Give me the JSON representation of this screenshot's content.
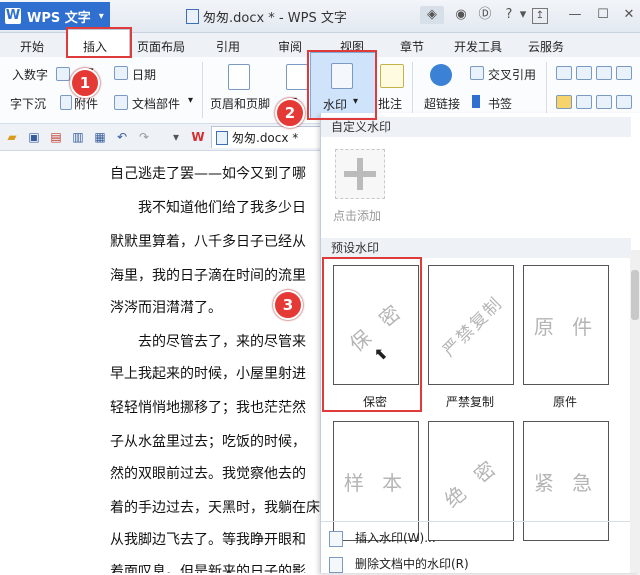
{
  "titlebar": {
    "app_name": "WPS 文字",
    "doc_title": "匆匆.docx * - WPS 文字",
    "help": "?"
  },
  "tabs": [
    {
      "label": "开始"
    },
    {
      "label": "插入"
    },
    {
      "label": "页面布局"
    },
    {
      "label": "引用"
    },
    {
      "label": "审阅"
    },
    {
      "label": "视图"
    },
    {
      "label": "章节"
    },
    {
      "label": "开发工具"
    },
    {
      "label": "云服务"
    }
  ],
  "ribbon": {
    "number": "入数字",
    "date": "日期",
    "sink": "字下沉",
    "attachment": "附件",
    "doc_parts": "文档部件",
    "header_footer": "页眉和页脚",
    "watermark": "水印",
    "comment": "批注",
    "cross_ref": "交叉引用",
    "hyperlink": "超链接",
    "bookmark": "书签"
  },
  "doc_tab": {
    "label": "匆匆.docx *"
  },
  "document": {
    "lines": [
      "自己逃走了罢——如今又到了哪",
      "　　我不知道他们给了我多少日",
      "默默里算着，八千多日子已经从",
      "海里，我的日子滴在时间的流里",
      "涔涔而泪潸潸了。",
      "　　去的尽管去了，来的尽管来",
      "早上我起来的时候，小屋里射进",
      "轻轻悄悄地挪移了；我也茫茫然",
      "子从水盆里过去；吃饭的时候，",
      "然的双眼前过去。我觉察他去的",
      "着的手边过去，天黑时，我躺在床",
      "从我脚边飞去了。等我睁开眼和",
      "着面叹息。但是新来的日子的影"
    ]
  },
  "panel": {
    "custom_header": "自定义水印",
    "add_label": "点击添加",
    "preset_header": "预设水印",
    "presets": [
      {
        "text": "保 密",
        "label": "保密"
      },
      {
        "text": "严禁复制",
        "label": "严禁复制"
      },
      {
        "text": "原 件",
        "label": "原件"
      },
      {
        "text": "样 本",
        "label": ""
      },
      {
        "text": "绝 密",
        "label": ""
      },
      {
        "text": "紧 急",
        "label": ""
      }
    ],
    "menu": [
      {
        "label": "插入水印(W)..."
      },
      {
        "label": "删除文档中的水印(R)"
      }
    ]
  },
  "badges": [
    "1",
    "2",
    "3"
  ],
  "colors": {
    "accent": "#2f6fd0",
    "highlight": "#e03b3b",
    "selected": "#cfe3fa"
  }
}
